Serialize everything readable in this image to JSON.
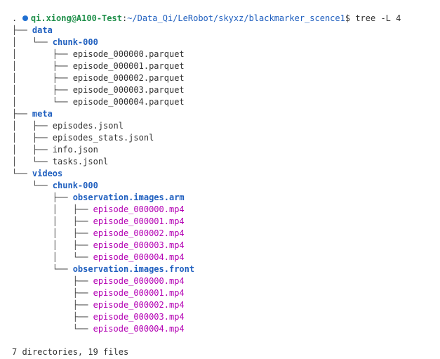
{
  "colors": {
    "prompt_dot": "#1f6fd1",
    "user_host": "#1f8f4a",
    "path": "#1f5fbf",
    "directory": "#1f5fbf",
    "file": "#333333",
    "media": "#b300b3",
    "background": "#ffffff"
  },
  "prompt": {
    "user_host": "qi.xiong@A100-Test",
    "separator": ":",
    "path": "~/Data_Qi/LeRobot/skyxz/blackmarker_scence1",
    "symbol": "$",
    "command": "tree -L 4"
  },
  "tree": [
    {
      "prefix": "",
      "name": ".",
      "kind": "file"
    },
    {
      "prefix": "├── ",
      "name": "data",
      "kind": "dir"
    },
    {
      "prefix": "│   └── ",
      "name": "chunk-000",
      "kind": "dir"
    },
    {
      "prefix": "│       ├── ",
      "name": "episode_000000.parquet",
      "kind": "file"
    },
    {
      "prefix": "│       ├── ",
      "name": "episode_000001.parquet",
      "kind": "file"
    },
    {
      "prefix": "│       ├── ",
      "name": "episode_000002.parquet",
      "kind": "file"
    },
    {
      "prefix": "│       ├── ",
      "name": "episode_000003.parquet",
      "kind": "file"
    },
    {
      "prefix": "│       └── ",
      "name": "episode_000004.parquet",
      "kind": "file"
    },
    {
      "prefix": "├── ",
      "name": "meta",
      "kind": "dir"
    },
    {
      "prefix": "│   ├── ",
      "name": "episodes.jsonl",
      "kind": "file"
    },
    {
      "prefix": "│   ├── ",
      "name": "episodes_stats.jsonl",
      "kind": "file"
    },
    {
      "prefix": "│   ├── ",
      "name": "info.json",
      "kind": "file"
    },
    {
      "prefix": "│   └── ",
      "name": "tasks.jsonl",
      "kind": "file"
    },
    {
      "prefix": "└── ",
      "name": "videos",
      "kind": "dir"
    },
    {
      "prefix": "    └── ",
      "name": "chunk-000",
      "kind": "dir"
    },
    {
      "prefix": "        ├── ",
      "name": "observation.images.arm",
      "kind": "dir"
    },
    {
      "prefix": "        │   ├── ",
      "name": "episode_000000.mp4",
      "kind": "media"
    },
    {
      "prefix": "        │   ├── ",
      "name": "episode_000001.mp4",
      "kind": "media"
    },
    {
      "prefix": "        │   ├── ",
      "name": "episode_000002.mp4",
      "kind": "media"
    },
    {
      "prefix": "        │   ├── ",
      "name": "episode_000003.mp4",
      "kind": "media"
    },
    {
      "prefix": "        │   └── ",
      "name": "episode_000004.mp4",
      "kind": "media"
    },
    {
      "prefix": "        └── ",
      "name": "observation.images.front",
      "kind": "dir"
    },
    {
      "prefix": "            ├── ",
      "name": "episode_000000.mp4",
      "kind": "media"
    },
    {
      "prefix": "            ├── ",
      "name": "episode_000001.mp4",
      "kind": "media"
    },
    {
      "prefix": "            ├── ",
      "name": "episode_000002.mp4",
      "kind": "media"
    },
    {
      "prefix": "            ├── ",
      "name": "episode_000003.mp4",
      "kind": "media"
    },
    {
      "prefix": "            └── ",
      "name": "episode_000004.mp4",
      "kind": "media"
    }
  ],
  "summary": "7 directories, 19 files"
}
